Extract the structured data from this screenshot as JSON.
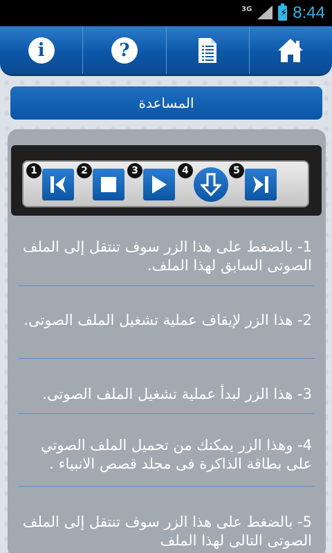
{
  "status_bar": {
    "network": "3G",
    "time": "8:44"
  },
  "nav": {
    "items": [
      {
        "name": "info",
        "icon": "info-icon",
        "glyph": "i"
      },
      {
        "name": "help",
        "icon": "help-icon",
        "glyph": "?"
      },
      {
        "name": "list",
        "icon": "document-list-icon"
      },
      {
        "name": "home",
        "icon": "home-icon"
      }
    ]
  },
  "title": "المساعدة",
  "controls": [
    {
      "number": "1",
      "icon": "skip-previous-icon"
    },
    {
      "number": "2",
      "icon": "stop-icon"
    },
    {
      "number": "3",
      "icon": "play-icon"
    },
    {
      "number": "4",
      "icon": "download-icon"
    },
    {
      "number": "5",
      "icon": "skip-next-icon"
    }
  ],
  "help_items": [
    {
      "text": "1- بالضغط على هذا الزر سوف تنتقل إلى الملف الصوتى السابق لهذا الملف."
    },
    {
      "text": "2- هذا الزر لإيقاف عملية تشغيل الملف الصوتى."
    },
    {
      "text": "3- هذا الزر لبدأ عملية تشغيل الملف الصوتى."
    },
    {
      "text": "4- وهذا الزر يمكنك من تحميل الملف الصوتي على بطاقة الذاكرة فى مجلد قصص الانبياء ."
    },
    {
      "text": "5- بالضغط على هذا الزر سوف تنتقل إلى الملف الصوتى التالى لهذا الملف"
    }
  ],
  "colors": {
    "accent": "#0c57a8",
    "status_time": "#33b5e5",
    "panel": "#a3a9b1"
  }
}
